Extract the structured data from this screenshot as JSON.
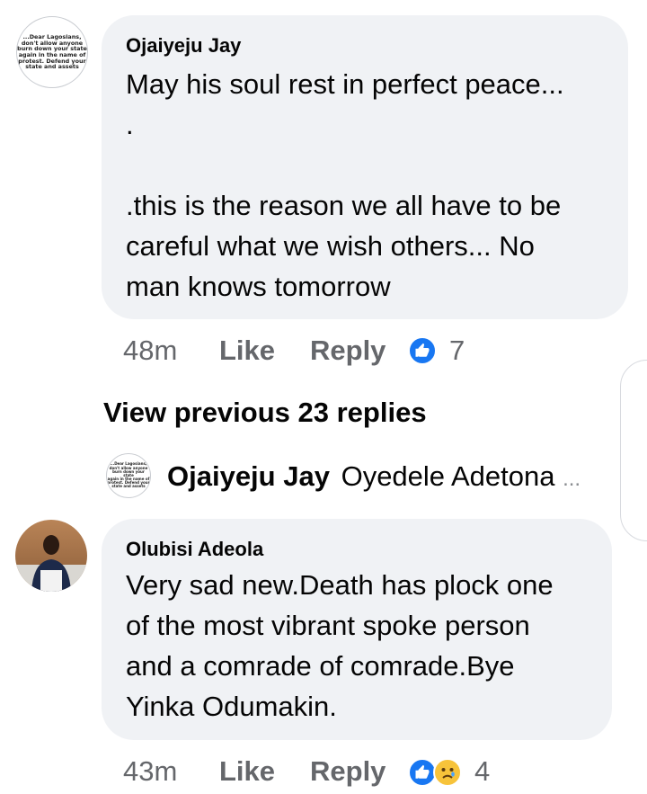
{
  "comment1": {
    "avatar_text": [
      "...Dear Lagosians,",
      "don't allow anyone",
      "burn down your state",
      "again in the name of",
      "protest. Defend your",
      "state and assets"
    ],
    "author": "Ojaiyeju Jay",
    "text": "May his soul rest in perfect peace...\n.\n\n.this is the reason we all have to be\ncareful what we wish others... No\nman knows tomorrow",
    "time": "48m",
    "like_label": "Like",
    "reply_label": "Reply",
    "reaction_count": "7",
    "reactions": [
      "like-icon"
    ]
  },
  "view_previous": "View previous 23 replies",
  "reply_preview": {
    "avatar_text": [
      "...Dear Lagosians,",
      "don't allow anyone",
      "burn down your state",
      "again in the name of",
      "protest. Defend your",
      "state and assets"
    ],
    "author": "Ojaiyeju Jay",
    "text": "Oyedele Adetona",
    "ellipsis": "..."
  },
  "comment2": {
    "author": "Olubisi Adeola",
    "text": "Very sad new.Death has plock one\nof the most vibrant spoke person\nand a comrade of comrade.Bye\nYinka Odumakin.",
    "time": "43m",
    "like_label": "Like",
    "reply_label": "Reply",
    "reaction_count": "4",
    "reactions": [
      "like-icon",
      "sad-icon"
    ]
  },
  "colors": {
    "bubble": "#f0f2f5",
    "meta": "#65676b",
    "like_blue": "#1877f2",
    "sad_yellow": "#f7c33a"
  }
}
